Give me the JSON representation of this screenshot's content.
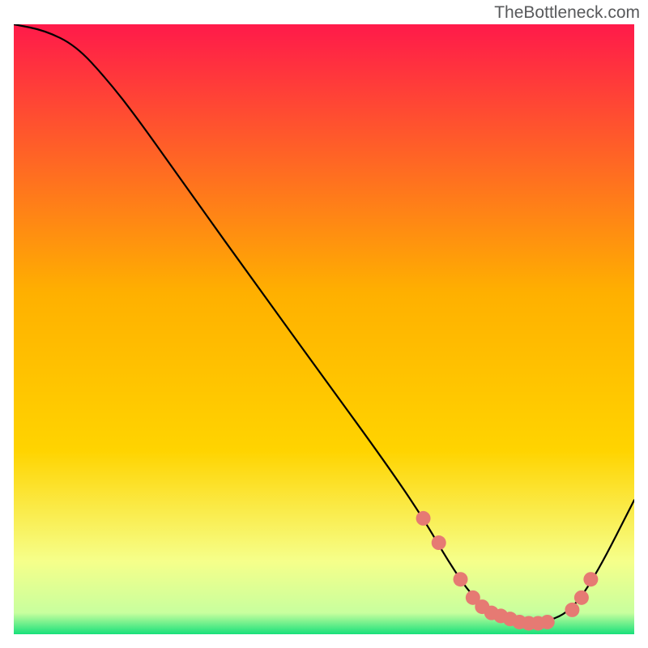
{
  "watermark": "TheBottleneck.com",
  "chart_data": {
    "type": "line",
    "title": "",
    "xlabel": "",
    "ylabel": "",
    "xlim": [
      0,
      100
    ],
    "ylim": [
      0,
      100
    ],
    "series": [
      {
        "name": "bottleneck-curve",
        "x": [
          0,
          5,
          10,
          15,
          20,
          28,
          40,
          50,
          60,
          66,
          70,
          74,
          78,
          82,
          86,
          90,
          94,
          100
        ],
        "y": [
          100,
          99,
          96.5,
          91,
          84.5,
          73,
          56,
          42,
          28,
          19,
          12,
          6,
          3,
          1.5,
          2,
          4,
          10,
          22
        ]
      }
    ],
    "markers": {
      "name": "data-points",
      "x": [
        66,
        68.5,
        72,
        74,
        75.5,
        77,
        78.5,
        80,
        81.5,
        83,
        84.5,
        86,
        90,
        91.5,
        93
      ],
      "y": [
        19,
        15,
        9,
        6,
        4.5,
        3.5,
        3,
        2.5,
        2,
        1.8,
        1.8,
        2,
        4,
        6,
        9
      ]
    },
    "colors": {
      "line": "#000000",
      "marker": "#e67a73",
      "gradient_top": "#ff1a4a",
      "gradient_mid": "#ffd400",
      "gradient_low": "#f6ff8a",
      "gradient_bottom": "#17e07a"
    }
  }
}
